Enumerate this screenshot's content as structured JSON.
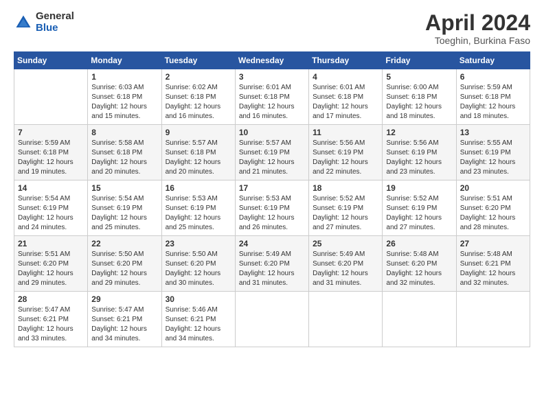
{
  "header": {
    "logo_general": "General",
    "logo_blue": "Blue",
    "month_year": "April 2024",
    "location": "Toeghin, Burkina Faso"
  },
  "weekdays": [
    "Sunday",
    "Monday",
    "Tuesday",
    "Wednesday",
    "Thursday",
    "Friday",
    "Saturday"
  ],
  "weeks": [
    [
      {
        "day": "",
        "sunrise": "",
        "sunset": "",
        "daylight": ""
      },
      {
        "day": "1",
        "sunrise": "Sunrise: 6:03 AM",
        "sunset": "Sunset: 6:18 PM",
        "daylight": "Daylight: 12 hours and 15 minutes."
      },
      {
        "day": "2",
        "sunrise": "Sunrise: 6:02 AM",
        "sunset": "Sunset: 6:18 PM",
        "daylight": "Daylight: 12 hours and 16 minutes."
      },
      {
        "day": "3",
        "sunrise": "Sunrise: 6:01 AM",
        "sunset": "Sunset: 6:18 PM",
        "daylight": "Daylight: 12 hours and 16 minutes."
      },
      {
        "day": "4",
        "sunrise": "Sunrise: 6:01 AM",
        "sunset": "Sunset: 6:18 PM",
        "daylight": "Daylight: 12 hours and 17 minutes."
      },
      {
        "day": "5",
        "sunrise": "Sunrise: 6:00 AM",
        "sunset": "Sunset: 6:18 PM",
        "daylight": "Daylight: 12 hours and 18 minutes."
      },
      {
        "day": "6",
        "sunrise": "Sunrise: 5:59 AM",
        "sunset": "Sunset: 6:18 PM",
        "daylight": "Daylight: 12 hours and 18 minutes."
      }
    ],
    [
      {
        "day": "7",
        "sunrise": "Sunrise: 5:59 AM",
        "sunset": "Sunset: 6:18 PM",
        "daylight": "Daylight: 12 hours and 19 minutes."
      },
      {
        "day": "8",
        "sunrise": "Sunrise: 5:58 AM",
        "sunset": "Sunset: 6:18 PM",
        "daylight": "Daylight: 12 hours and 20 minutes."
      },
      {
        "day": "9",
        "sunrise": "Sunrise: 5:57 AM",
        "sunset": "Sunset: 6:18 PM",
        "daylight": "Daylight: 12 hours and 20 minutes."
      },
      {
        "day": "10",
        "sunrise": "Sunrise: 5:57 AM",
        "sunset": "Sunset: 6:19 PM",
        "daylight": "Daylight: 12 hours and 21 minutes."
      },
      {
        "day": "11",
        "sunrise": "Sunrise: 5:56 AM",
        "sunset": "Sunset: 6:19 PM",
        "daylight": "Daylight: 12 hours and 22 minutes."
      },
      {
        "day": "12",
        "sunrise": "Sunrise: 5:56 AM",
        "sunset": "Sunset: 6:19 PM",
        "daylight": "Daylight: 12 hours and 23 minutes."
      },
      {
        "day": "13",
        "sunrise": "Sunrise: 5:55 AM",
        "sunset": "Sunset: 6:19 PM",
        "daylight": "Daylight: 12 hours and 23 minutes."
      }
    ],
    [
      {
        "day": "14",
        "sunrise": "Sunrise: 5:54 AM",
        "sunset": "Sunset: 6:19 PM",
        "daylight": "Daylight: 12 hours and 24 minutes."
      },
      {
        "day": "15",
        "sunrise": "Sunrise: 5:54 AM",
        "sunset": "Sunset: 6:19 PM",
        "daylight": "Daylight: 12 hours and 25 minutes."
      },
      {
        "day": "16",
        "sunrise": "Sunrise: 5:53 AM",
        "sunset": "Sunset: 6:19 PM",
        "daylight": "Daylight: 12 hours and 25 minutes."
      },
      {
        "day": "17",
        "sunrise": "Sunrise: 5:53 AM",
        "sunset": "Sunset: 6:19 PM",
        "daylight": "Daylight: 12 hours and 26 minutes."
      },
      {
        "day": "18",
        "sunrise": "Sunrise: 5:52 AM",
        "sunset": "Sunset: 6:19 PM",
        "daylight": "Daylight: 12 hours and 27 minutes."
      },
      {
        "day": "19",
        "sunrise": "Sunrise: 5:52 AM",
        "sunset": "Sunset: 6:19 PM",
        "daylight": "Daylight: 12 hours and 27 minutes."
      },
      {
        "day": "20",
        "sunrise": "Sunrise: 5:51 AM",
        "sunset": "Sunset: 6:20 PM",
        "daylight": "Daylight: 12 hours and 28 minutes."
      }
    ],
    [
      {
        "day": "21",
        "sunrise": "Sunrise: 5:51 AM",
        "sunset": "Sunset: 6:20 PM",
        "daylight": "Daylight: 12 hours and 29 minutes."
      },
      {
        "day": "22",
        "sunrise": "Sunrise: 5:50 AM",
        "sunset": "Sunset: 6:20 PM",
        "daylight": "Daylight: 12 hours and 29 minutes."
      },
      {
        "day": "23",
        "sunrise": "Sunrise: 5:50 AM",
        "sunset": "Sunset: 6:20 PM",
        "daylight": "Daylight: 12 hours and 30 minutes."
      },
      {
        "day": "24",
        "sunrise": "Sunrise: 5:49 AM",
        "sunset": "Sunset: 6:20 PM",
        "daylight": "Daylight: 12 hours and 31 minutes."
      },
      {
        "day": "25",
        "sunrise": "Sunrise: 5:49 AM",
        "sunset": "Sunset: 6:20 PM",
        "daylight": "Daylight: 12 hours and 31 minutes."
      },
      {
        "day": "26",
        "sunrise": "Sunrise: 5:48 AM",
        "sunset": "Sunset: 6:20 PM",
        "daylight": "Daylight: 12 hours and 32 minutes."
      },
      {
        "day": "27",
        "sunrise": "Sunrise: 5:48 AM",
        "sunset": "Sunset: 6:21 PM",
        "daylight": "Daylight: 12 hours and 32 minutes."
      }
    ],
    [
      {
        "day": "28",
        "sunrise": "Sunrise: 5:47 AM",
        "sunset": "Sunset: 6:21 PM",
        "daylight": "Daylight: 12 hours and 33 minutes."
      },
      {
        "day": "29",
        "sunrise": "Sunrise: 5:47 AM",
        "sunset": "Sunset: 6:21 PM",
        "daylight": "Daylight: 12 hours and 34 minutes."
      },
      {
        "day": "30",
        "sunrise": "Sunrise: 5:46 AM",
        "sunset": "Sunset: 6:21 PM",
        "daylight": "Daylight: 12 hours and 34 minutes."
      },
      {
        "day": "",
        "sunrise": "",
        "sunset": "",
        "daylight": ""
      },
      {
        "day": "",
        "sunrise": "",
        "sunset": "",
        "daylight": ""
      },
      {
        "day": "",
        "sunrise": "",
        "sunset": "",
        "daylight": ""
      },
      {
        "day": "",
        "sunrise": "",
        "sunset": "",
        "daylight": ""
      }
    ]
  ]
}
